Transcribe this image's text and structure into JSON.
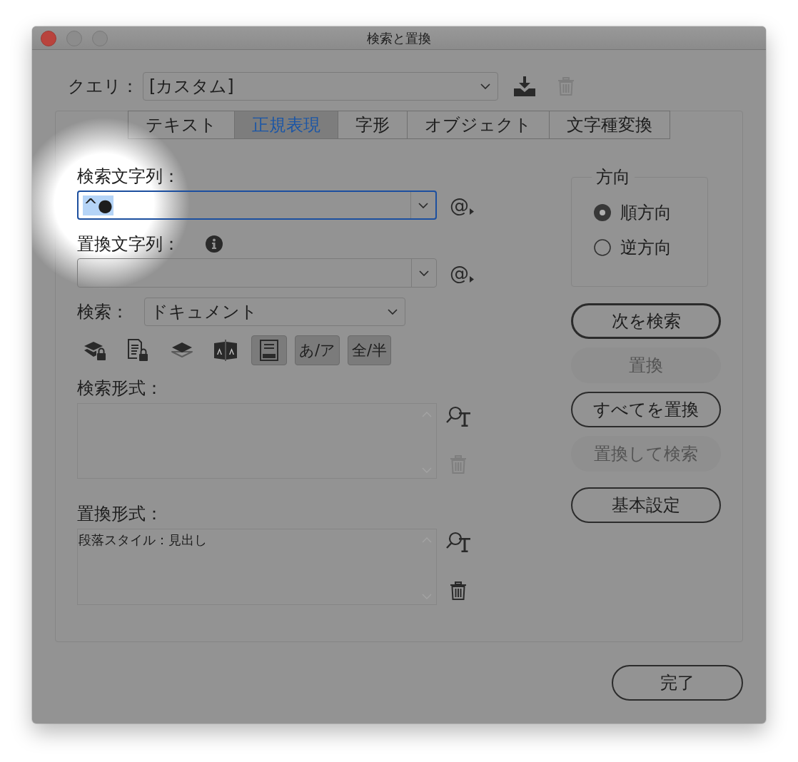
{
  "window": {
    "title": "検索と置換",
    "controls": [
      {
        "kind": "close",
        "disabled": false
      },
      {
        "kind": "minimize",
        "disabled": true
      },
      {
        "kind": "zoom",
        "disabled": true
      }
    ]
  },
  "query": {
    "label": "クエリ：",
    "value": "[カスタム]",
    "save_disabled": false,
    "delete_disabled": true
  },
  "tabs": [
    {
      "label": "テキスト",
      "selected": false
    },
    {
      "label": "正規表現",
      "selected": true
    },
    {
      "label": "字形",
      "selected": false
    },
    {
      "label": "オブジェクト",
      "selected": false
    },
    {
      "label": "文字種変換",
      "selected": false
    }
  ],
  "find_what": {
    "label": "検索文字列：",
    "value": "^●",
    "focused": true,
    "text_selected": true,
    "spotlight": true,
    "menu_label": "@"
  },
  "change_to": {
    "label": "置換文字列：",
    "focused": false,
    "menu_label": "@"
  },
  "search": {
    "label": "検索：",
    "value": "ドキュメント"
  },
  "options": [
    {
      "kind": "locked_layers",
      "pressed": false
    },
    {
      "kind": "locked_stories",
      "pressed": false
    },
    {
      "kind": "hidden_layers",
      "pressed": false
    },
    {
      "kind": "master_pages",
      "pressed": false
    },
    {
      "kind": "footnotes",
      "pressed": true
    },
    {
      "kind": "kana",
      "label": "あ/ア",
      "pressed": true
    },
    {
      "kind": "width",
      "label": "全/半",
      "pressed": true
    }
  ],
  "find_format": {
    "label": "検索形式：",
    "delete_disabled": true
  },
  "change_format": {
    "label": "置換形式：",
    "value": "段落スタイル：見出し",
    "delete_disabled": false
  },
  "direction": {
    "title": "方向",
    "options": [
      {
        "label": "順方向",
        "selected": true
      },
      {
        "label": "逆方向",
        "selected": false
      }
    ]
  },
  "actions": [
    {
      "label": "次を検索",
      "default": true,
      "disabled": false
    },
    {
      "label": "置換",
      "default": false,
      "disabled": true
    },
    {
      "label": "すべてを置換",
      "default": false,
      "disabled": false
    },
    {
      "label": "置換して検索",
      "default": false,
      "disabled": true
    },
    {
      "label": "基本設定",
      "default": false,
      "disabled": false
    }
  ],
  "done_button": {
    "label": "完了"
  }
}
